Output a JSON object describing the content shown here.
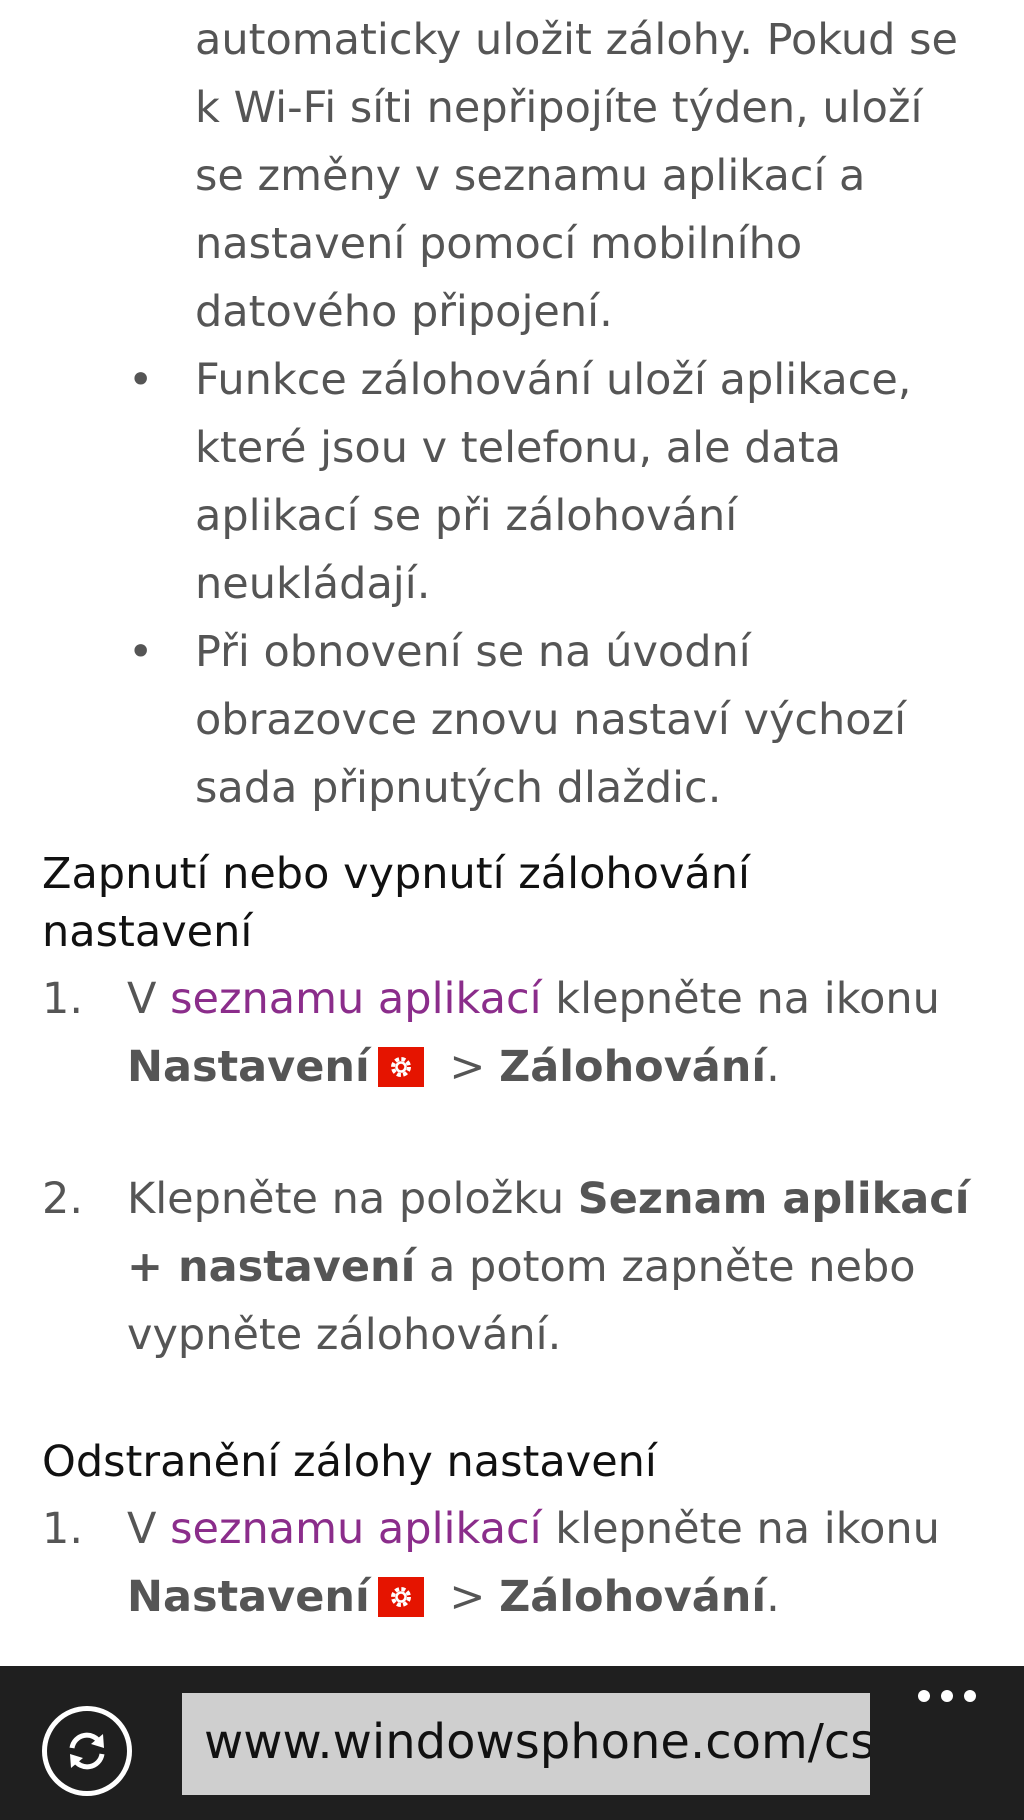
{
  "article": {
    "intro_lines": [
      "automaticky uložit zálohy. Pokud se",
      "k Wi-Fi síti nepřipojíte týden, uloží",
      "se změny v seznamu aplikací a",
      "nastavení pomocí mobilního",
      "datového připojení."
    ],
    "bullets": [
      {
        "symbol": "•",
        "lines": [
          "Funkce zálohování uloží aplikace,",
          "které jsou v telefonu, ale data",
          "aplikací se při zálohování",
          "neukládají."
        ]
      },
      {
        "symbol": "•",
        "lines": [
          "Při obnovení se na úvodní",
          "obrazovce znovu nastaví výchozí",
          "sada připnutých dlaždic."
        ]
      }
    ],
    "section1": {
      "heading_line1": "Zapnutí nebo vypnutí zálohování",
      "heading_line2": "nastavení",
      "step1": {
        "num": "1.",
        "prefix": "V ",
        "link": "seznamu aplikací",
        "suffix": " klepněte na ikonu",
        "bold1": "Nastavení",
        "sep": " > ",
        "bold2": "Zálohování",
        "end": "."
      },
      "step2": {
        "num": "2.",
        "prefix": "Klepněte na položku ",
        "bold1": "Seznam aplikací",
        "bold2": "+ nastavení",
        "mid": " a potom zapněte nebo",
        "line3": "vypněte zálohování."
      }
    },
    "section2": {
      "heading": "Odstranění zálohy nastavení",
      "step1": {
        "num": "1.",
        "prefix": "V ",
        "link": "seznamu aplikací",
        "suffix": " klepněte na ikonu",
        "bold1": "Nastavení",
        "sep": " > ",
        "bold2": "Zálohování",
        "end": "."
      }
    }
  },
  "browser_bar": {
    "address": "www.windowsphone.com/cs",
    "refresh_icon": "refresh-icon",
    "more_icon": "more-icon"
  },
  "colors": {
    "link": "#8b2d8b",
    "settings_icon_bg": "#e51400",
    "bar_bg": "#1f1f1f",
    "address_bg": "#cfcfcf"
  }
}
